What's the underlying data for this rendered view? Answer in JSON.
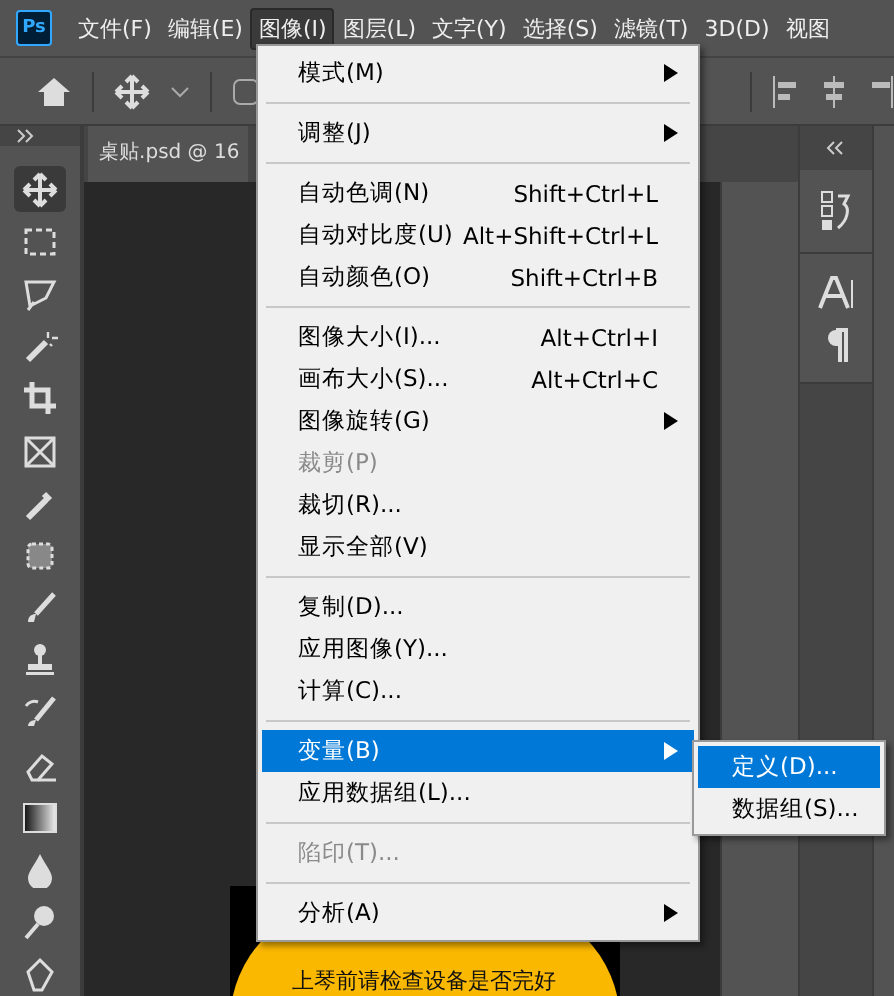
{
  "app_logo": {
    "text": "Ps"
  },
  "menubar": {
    "items": [
      {
        "label": "文件(F)",
        "selected": false
      },
      {
        "label": "编辑(E)",
        "selected": false
      },
      {
        "label": "图像(I)",
        "selected": true
      },
      {
        "label": "图层(L)",
        "selected": false
      },
      {
        "label": "文字(Y)",
        "selected": false
      },
      {
        "label": "选择(S)",
        "selected": false
      },
      {
        "label": "滤镜(T)",
        "selected": false
      },
      {
        "label": "3D(D)",
        "selected": false
      },
      {
        "label": "视图",
        "selected": false
      }
    ]
  },
  "document_tab": {
    "label": "桌贴.psd @ 16"
  },
  "canvas": {
    "text": "上琴前请检查设备是否完好"
  },
  "menu": {
    "items": [
      {
        "kind": "item",
        "label": "模式(M)",
        "submenu": true,
        "disabled": false,
        "selected": false
      },
      {
        "kind": "separator"
      },
      {
        "kind": "item",
        "label": "调整(J)",
        "submenu": true,
        "disabled": false,
        "selected": false
      },
      {
        "kind": "separator"
      },
      {
        "kind": "item",
        "label": "自动色调(N)",
        "shortcut": "Shift+Ctrl+L",
        "submenu": false,
        "disabled": false,
        "selected": false
      },
      {
        "kind": "item",
        "label": "自动对比度(U)",
        "shortcut": "Alt+Shift+Ctrl+L",
        "submenu": false,
        "disabled": false,
        "selected": false
      },
      {
        "kind": "item",
        "label": "自动颜色(O)",
        "shortcut": "Shift+Ctrl+B",
        "submenu": false,
        "disabled": false,
        "selected": false
      },
      {
        "kind": "separator"
      },
      {
        "kind": "item",
        "label": "图像大小(I)...",
        "shortcut": "Alt+Ctrl+I",
        "submenu": false,
        "disabled": false,
        "selected": false
      },
      {
        "kind": "item",
        "label": "画布大小(S)...",
        "shortcut": "Alt+Ctrl+C",
        "submenu": false,
        "disabled": false,
        "selected": false
      },
      {
        "kind": "item",
        "label": "图像旋转(G)",
        "submenu": true,
        "disabled": false,
        "selected": false
      },
      {
        "kind": "item",
        "label": "裁剪(P)",
        "submenu": false,
        "disabled": true,
        "selected": false
      },
      {
        "kind": "item",
        "label": "裁切(R)...",
        "submenu": false,
        "disabled": false,
        "selected": false
      },
      {
        "kind": "item",
        "label": "显示全部(V)",
        "submenu": false,
        "disabled": false,
        "selected": false
      },
      {
        "kind": "separator"
      },
      {
        "kind": "item",
        "label": "复制(D)...",
        "submenu": false,
        "disabled": false,
        "selected": false
      },
      {
        "kind": "item",
        "label": "应用图像(Y)...",
        "submenu": false,
        "disabled": false,
        "selected": false
      },
      {
        "kind": "item",
        "label": "计算(C)...",
        "submenu": false,
        "disabled": false,
        "selected": false
      },
      {
        "kind": "separator"
      },
      {
        "kind": "item",
        "label": "变量(B)",
        "submenu": true,
        "disabled": false,
        "selected": true
      },
      {
        "kind": "item",
        "label": "应用数据组(L)...",
        "submenu": false,
        "disabled": false,
        "selected": false
      },
      {
        "kind": "separator"
      },
      {
        "kind": "item",
        "label": "陷印(T)...",
        "submenu": false,
        "disabled": true,
        "selected": false
      },
      {
        "kind": "separator"
      },
      {
        "kind": "item",
        "label": "分析(A)",
        "submenu": true,
        "disabled": false,
        "selected": false
      }
    ]
  },
  "submenu": {
    "items": [
      {
        "label": "定义(D)...",
        "selected": true
      },
      {
        "label": "数据组(S)...",
        "selected": false
      }
    ]
  }
}
